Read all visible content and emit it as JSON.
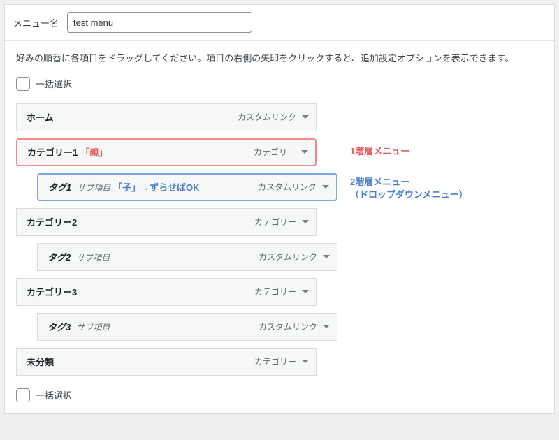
{
  "header": {
    "label": "メニュー名",
    "value": "test menu"
  },
  "instruction": "好みの順番に各項目をドラッグしてください。項目の右側の矢印をクリックすると、追加設定オプションを表示できます。",
  "bulkSelect": "一括選択",
  "items": {
    "home": {
      "title": "ホーム",
      "type": "カスタムリンク"
    },
    "cat1": {
      "title": "カテゴリー1",
      "type": "カテゴリー",
      "note": "「親」"
    },
    "tag1": {
      "title": "タグ1",
      "type": "カスタムリンク",
      "sub": "サブ項目",
      "note": "「子」→ずらせばOK"
    },
    "cat2": {
      "title": "カテゴリー2",
      "type": "カテゴリー"
    },
    "tag2": {
      "title": "タグ2",
      "type": "カスタムリンク",
      "sub": "サブ項目"
    },
    "cat3": {
      "title": "カテゴリー3",
      "type": "カテゴリー"
    },
    "tag3": {
      "title": "タグ3",
      "type": "カスタムリンク",
      "sub": "サブ項目"
    },
    "uncat": {
      "title": "未分類",
      "type": "カテゴリー"
    }
  },
  "annotations": {
    "level1": "1階層メニュー",
    "level2a": "2階層メニュー",
    "level2b": "（ドロップダウンメニュー）"
  }
}
